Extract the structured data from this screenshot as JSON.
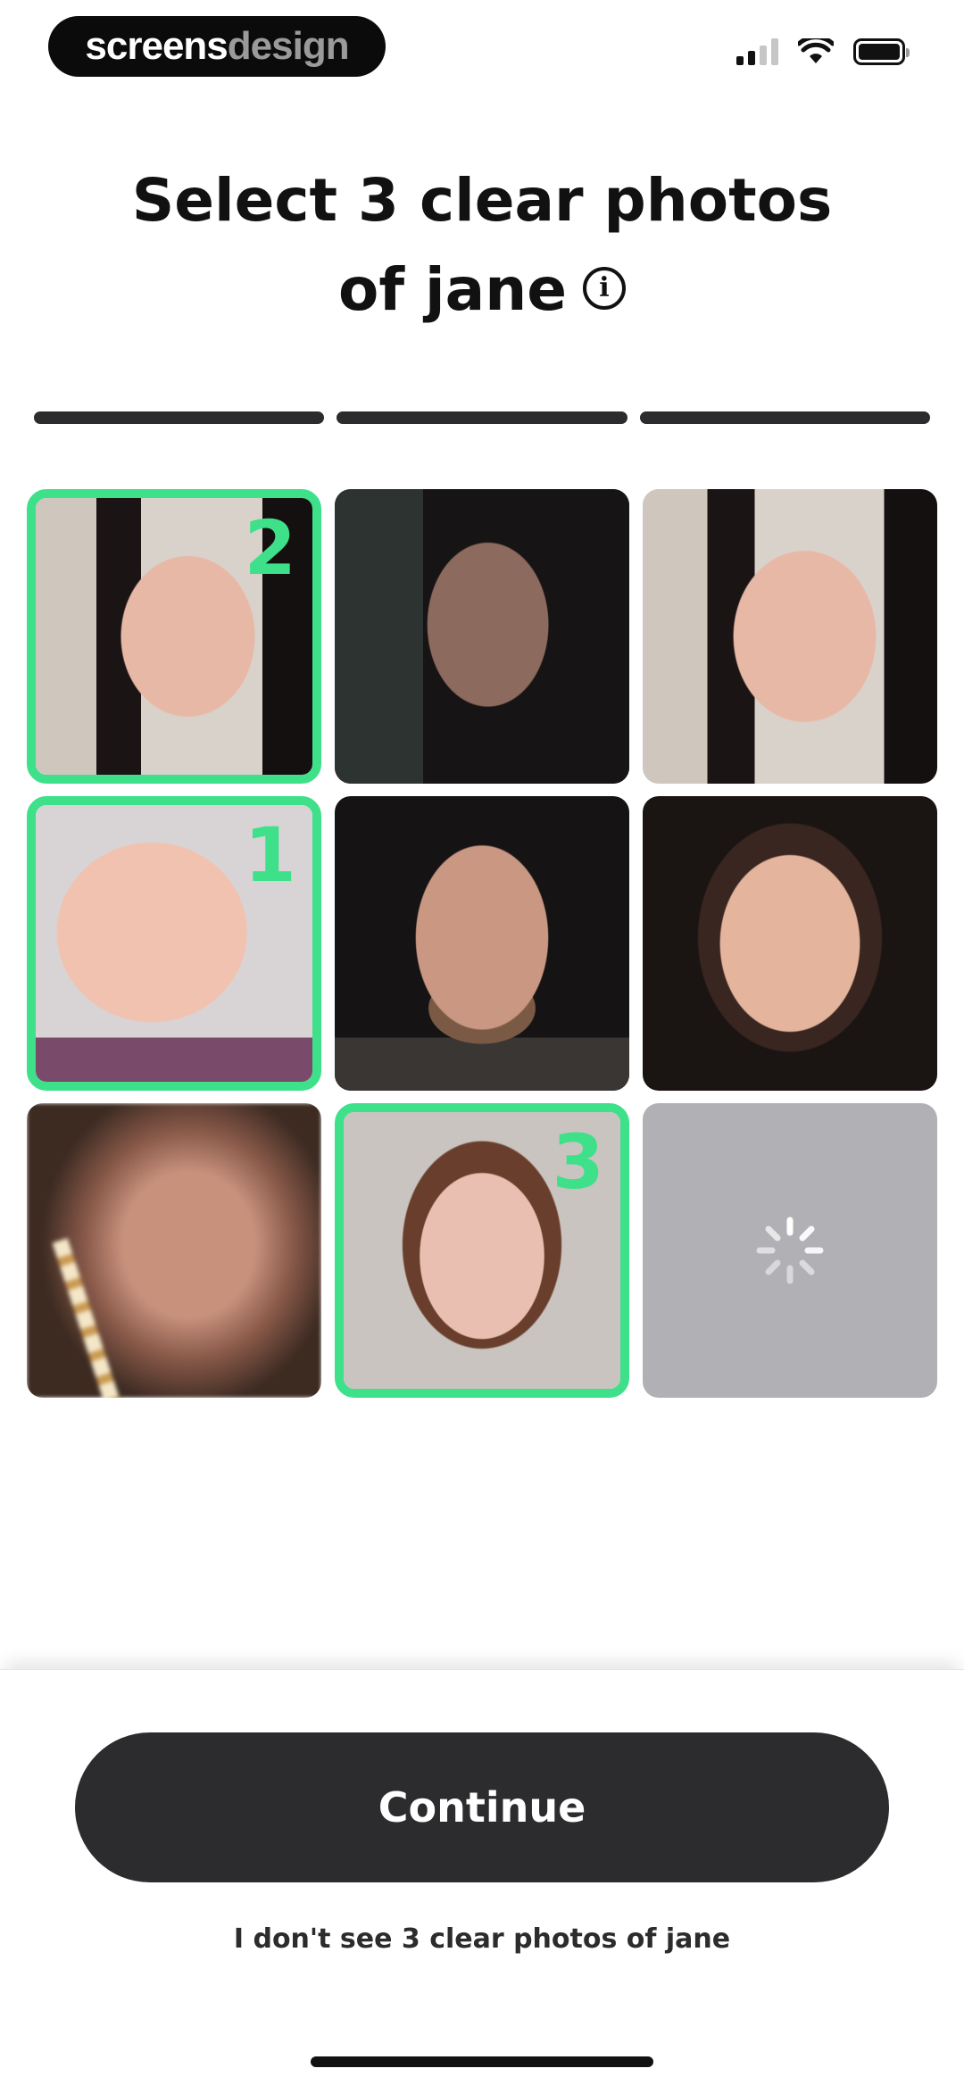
{
  "status_bar": {
    "watermark_part1": "screens",
    "watermark_part2": "design",
    "icons": [
      "signal-icon",
      "wifi-icon",
      "battery-icon"
    ]
  },
  "header": {
    "title_line1": "Select 3 clear photos",
    "title_line2": "of jane",
    "info_glyph": "i"
  },
  "progress": {
    "segments_total": 3,
    "segments_filled": 3
  },
  "grid": {
    "tiles": [
      {
        "name": "woman-dark-hair-portrait",
        "selected": true,
        "order": "2"
      },
      {
        "name": "woman-dark-moody-portrait",
        "selected": false,
        "order": ""
      },
      {
        "name": "woman-dark-hair-portrait-duplicate",
        "selected": false,
        "order": ""
      },
      {
        "name": "baby-portrait",
        "selected": true,
        "order": "1"
      },
      {
        "name": "bearded-man-portrait",
        "selected": false,
        "order": ""
      },
      {
        "name": "smiling-woman-portrait",
        "selected": false,
        "order": ""
      },
      {
        "name": "blurry-portrait",
        "selected": false,
        "order": ""
      },
      {
        "name": "freckled-woman-portrait",
        "selected": true,
        "order": "3"
      },
      {
        "name": "loading-tile",
        "selected": false,
        "order": "",
        "loading": true
      }
    ],
    "selected_color": "#3ee08a"
  },
  "footer": {
    "continue_label": "Continue",
    "no_match_label": "I don't see 3 clear photos of jane"
  },
  "colors": {
    "accent": "#3ee08a",
    "button_bg": "#2c2c2e",
    "loading_tile": "#b1b0b4"
  }
}
